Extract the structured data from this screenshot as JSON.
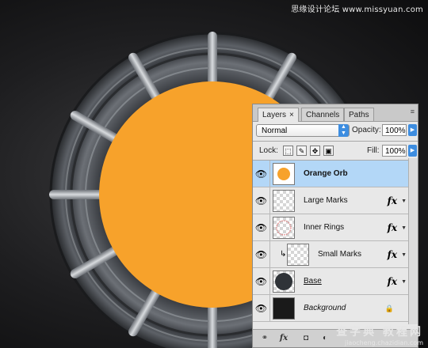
{
  "watermark_top": "思缘设计论坛 www.missyuan.com",
  "watermark_bottom": {
    "main": "查字典 教程网",
    "url": "jiaocheng.chazidian.com"
  },
  "colors": {
    "orb": "#f7a22b",
    "selection": "#b3d7f7",
    "accent": "#3d8de0"
  },
  "layers_panel": {
    "tabs": [
      {
        "label": "Layers",
        "close": "×"
      },
      {
        "label": "Channels"
      },
      {
        "label": "Paths"
      }
    ],
    "menu_icon": "≡",
    "blend_mode": "Normal",
    "opacity_label": "Opacity:",
    "opacity_value": "100%",
    "lock_label": "Lock:",
    "fill_label": "Fill:",
    "fill_value": "100%",
    "layers": [
      {
        "name": "Orange Orb",
        "selected": true,
        "fx": ""
      },
      {
        "name": "Large Marks",
        "selected": false,
        "fx": "fx"
      },
      {
        "name": "Inner Rings",
        "selected": false,
        "fx": "fx"
      },
      {
        "name": "Small Marks",
        "selected": false,
        "fx": "fx",
        "clipped": true
      },
      {
        "name": "Base",
        "selected": false,
        "fx": "fx"
      },
      {
        "name": "Background",
        "selected": false,
        "fx": "",
        "locked": true
      }
    ],
    "bottom_fx": "fx"
  }
}
